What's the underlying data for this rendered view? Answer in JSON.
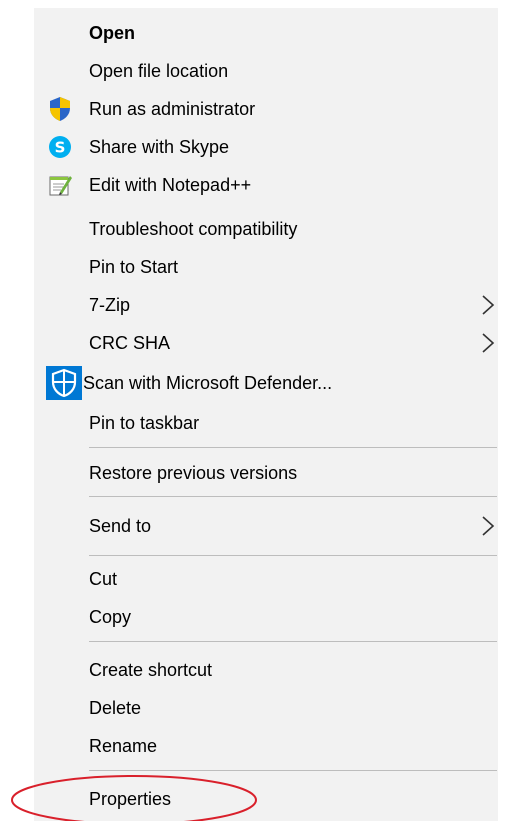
{
  "menu": {
    "items": [
      {
        "label": "Open"
      },
      {
        "label": "Open file location"
      },
      {
        "label": "Run as administrator",
        "icon": "uac-shield-icon"
      },
      {
        "label": "Share with Skype",
        "icon": "skype-icon"
      },
      {
        "label": "Edit with Notepad++",
        "icon": "notepadpp-icon"
      },
      {
        "label": "Troubleshoot compatibility"
      },
      {
        "label": "Pin to Start"
      },
      {
        "label": "7-Zip",
        "icon": "chevron-right-icon"
      },
      {
        "label": "CRC SHA",
        "icon": "chevron-right-icon"
      },
      {
        "label": "Scan with Microsoft Defender...",
        "icon": "defender-shield-icon"
      },
      {
        "label": "Pin to taskbar"
      },
      {
        "label": "Restore previous versions"
      },
      {
        "label": "Send to",
        "icon": "chevron-right-icon"
      },
      {
        "label": "Cut"
      },
      {
        "label": "Copy"
      },
      {
        "label": "Create shortcut"
      },
      {
        "label": "Delete"
      },
      {
        "label": "Rename"
      },
      {
        "label": "Properties"
      }
    ]
  },
  "colors": {
    "menu_background": "#f2f2f2",
    "separator": "#bdbdbd",
    "highlight_ellipse": "#d9202b",
    "uac_shield_blue": "#2a66c8",
    "uac_shield_yellow": "#f5c400",
    "skype_blue": "#00aff0",
    "defender_blue": "#0078d4"
  }
}
